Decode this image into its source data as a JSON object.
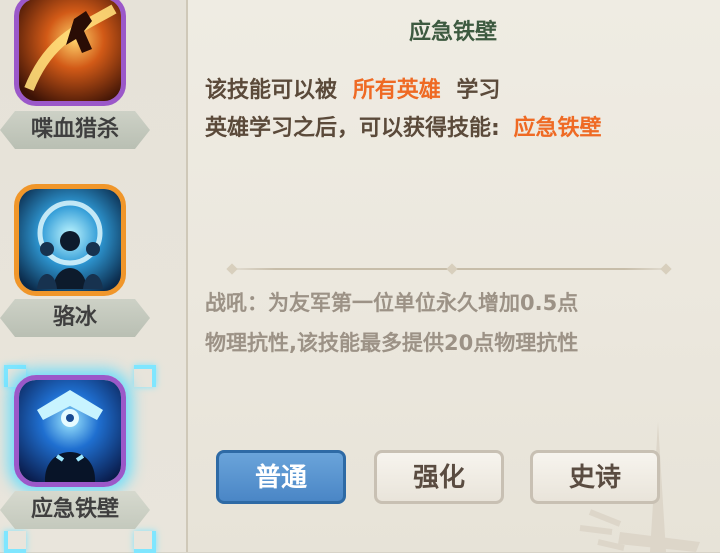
{
  "sidebar": {
    "skills": [
      {
        "label": "喋血猎杀",
        "icon": "blood-hunt-icon",
        "frame_color": "#9b58c9"
      },
      {
        "label": "骆冰",
        "icon": "frost-warriors-icon",
        "frame_color": "#f0962a"
      },
      {
        "label": "应急铁壁",
        "icon": "iron-wall-icon",
        "frame_color": "#9b58c9",
        "selected": true
      }
    ]
  },
  "panel": {
    "title": "应急铁壁",
    "line1_prefix": "该技能可以被",
    "line1_highlight": "所有英雄",
    "line1_suffix": "学习",
    "line2_prefix": "英雄学习之后，可以获得技能:",
    "line2_highlight": "应急铁壁",
    "description_line1": "战吼：为友军第一位单位永久增加0.5点",
    "description_line2": "物理抗性,该技能最多提供20点物理抗性",
    "highlight_color": "#ef6a24"
  },
  "tabs": {
    "normal": "普通",
    "enhance": "强化",
    "epic": "史诗",
    "active": "普通"
  }
}
